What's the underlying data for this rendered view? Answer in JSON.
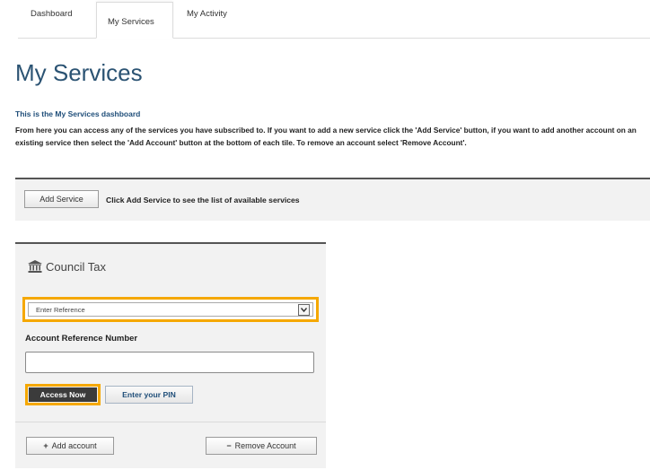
{
  "tabs": [
    {
      "label": "Dashboard",
      "active": false
    },
    {
      "label": "My Services",
      "active": true
    },
    {
      "label": "My Activity",
      "active": false
    }
  ],
  "page": {
    "title": "My Services",
    "intro_title": "This is the My Services dashboard",
    "intro_text": "From here you can access any of the services you have subscribed to. If you want to add a new service click the 'Add Service' button, if you want to add another account on an existing service then select the 'Add Account' button at the bottom of each tile. To remove an account select 'Remove Account'."
  },
  "service_bar": {
    "add_service_label": "Add Service",
    "hint": "Click Add Service to see the list of available services"
  },
  "tile": {
    "icon": "building-icon",
    "title": "Council Tax",
    "select_value": "Enter Reference",
    "field_label": "Account Reference Number",
    "field_value": "",
    "access_label": "Access Now",
    "pin_label": "Enter your PIN",
    "add_account_symbol": "+",
    "add_account_label": "Add account",
    "remove_account_symbol": "−",
    "remove_account_label": "Remove Account"
  },
  "colors": {
    "title": "#2b5373",
    "highlight": "#f5a800",
    "primary_button": "#3b3b3b",
    "panel_bg": "#f2f2f2"
  }
}
